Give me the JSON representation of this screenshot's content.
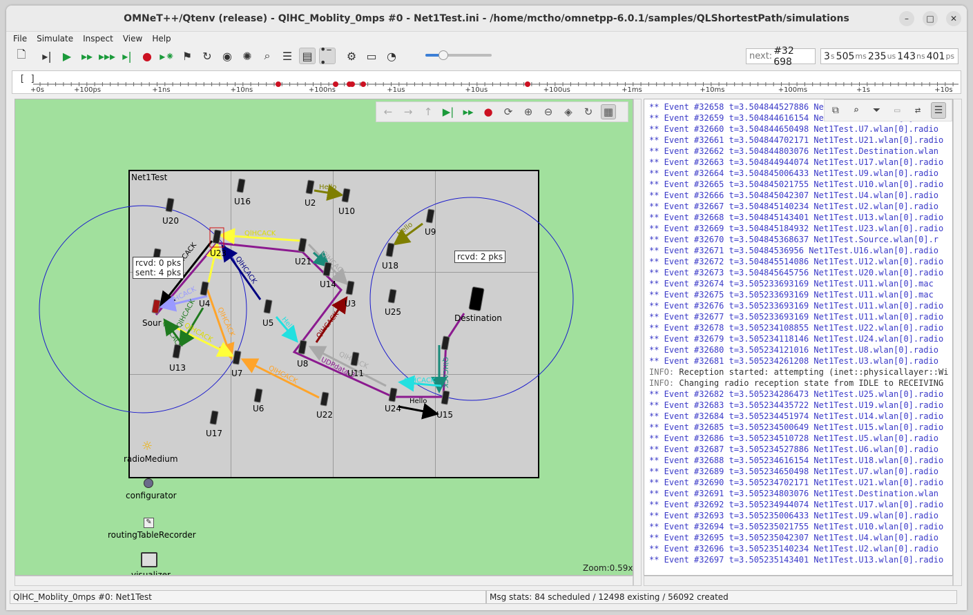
{
  "window": {
    "title": "OMNeT++/Qtenv (release) - QlHC_Moblity_0mps #0 - Net1Test.ini - /home/mctho/omnetpp-6.0.1/samples/QLShortestPath/simulations",
    "minimize_icon": "minimize-icon",
    "maximize_icon": "maximize-icon",
    "close_icon": "close-icon"
  },
  "menu": [
    "File",
    "Simulate",
    "Inspect",
    "View",
    "Help"
  ],
  "toolbar": {
    "icons": [
      "new-file-icon",
      "step-icon",
      "run-icon",
      "fast-run-icon",
      "express-run-icon",
      "run-until-icon",
      "stop-icon",
      "rebuild-icon",
      "flag-icon",
      "refresh-icon",
      "record-icon",
      "debug-icon",
      "find-icon",
      "layout-list-icon",
      "layout-split-icon",
      "layout-timeline-icon",
      "settings-icon",
      "camera-icon",
      "speed-icon"
    ],
    "speed_slider_level": 0.27
  },
  "status": {
    "next_label": "next:",
    "next_value": "#32 698",
    "sim_time": [
      {
        "value": "3",
        "unit": "s"
      },
      {
        "value": "505",
        "unit": "ms"
      },
      {
        "value": "235",
        "unit": "us"
      },
      {
        "value": "143",
        "unit": "ns"
      },
      {
        "value": "401",
        "unit": "ps"
      }
    ]
  },
  "timeline": {
    "labels": [
      "+0s",
      "+100ps",
      "+1ns",
      "+10ns",
      "+100ns",
      "+1us",
      "+10us",
      "+100us",
      "+1ms",
      "+10ms",
      "+100ms",
      "+1s",
      "+10s"
    ],
    "bracket": "[   ]",
    "event_markers": 6
  },
  "canvas": {
    "network_name": "Net1Test",
    "zoom": "Zoom:0.59x",
    "nodes": [
      "U16",
      "U2",
      "U10",
      "U20",
      "U9",
      "U23",
      "U21",
      "U18",
      "U14",
      "U3",
      "U4",
      "U5",
      "U25",
      "Source",
      "U8",
      "U13",
      "U7",
      "U11",
      "U24",
      "U15",
      "U6",
      "U22",
      "U17",
      "Destination"
    ],
    "source_label": "Sour",
    "bubbles": {
      "source": [
        "rcvd: 0 pks",
        "sent: 4 pks"
      ],
      "destination": "rcvd: 2 pks"
    },
    "messages": [
      "Hello",
      "Hello",
      "QlHCACK",
      "QlHCACK",
      "QlHCACK",
      "QlHCACK",
      "QlHCACK",
      "QlHCACK",
      "QlHCACK",
      "QlHCACK",
      "QlHCACK",
      "QlHCACK",
      "Hello",
      "QlHCACK",
      "UDPdata-3",
      "QlHCACK",
      "QlHCACK",
      "QlHCACK",
      "Hello"
    ],
    "modules": [
      "radioMedium",
      "configurator",
      "routingTableRecorder",
      "visualizer"
    ],
    "toolbar_icons": [
      "back-icon",
      "forward-icon",
      "up-icon",
      "run-local-icon",
      "fast-local-icon",
      "stop-local-icon",
      "relayout-icon",
      "zoom-in-icon",
      "zoom-out-icon",
      "layers-icon",
      "3d-icon",
      "canvas-mode-icon"
    ]
  },
  "log": {
    "toolbar_icons": [
      "copy-icon",
      "find-log-icon",
      "filter-icon",
      "settings-log-icon",
      "module-log-icon",
      "messages-view-icon"
    ],
    "lines": [
      {
        "t": "event",
        "text": "** Event #32658  t=3.504844527886  Net1Test.U6.wlan[0].radio"
      },
      {
        "t": "event",
        "text": "** Event #32659  t=3.504844616154  Net1Test.U18.wlan[0].radio"
      },
      {
        "t": "event",
        "text": "** Event #32660  t=3.504844650498  Net1Test.U7.wlan[0].radio"
      },
      {
        "t": "event",
        "text": "** Event #32661  t=3.504844702171  Net1Test.U21.wlan[0].radio"
      },
      {
        "t": "event",
        "text": "** Event #32662  t=3.504844803076  Net1Test.Destination.wlan"
      },
      {
        "t": "event",
        "text": "** Event #32663  t=3.504844944074  Net1Test.U17.wlan[0].radio"
      },
      {
        "t": "event",
        "text": "** Event #32664  t=3.504845006433  Net1Test.U9.wlan[0].radio"
      },
      {
        "t": "event",
        "text": "** Event #32665  t=3.504845021755  Net1Test.U10.wlan[0].radio"
      },
      {
        "t": "event",
        "text": "** Event #32666  t=3.504845042307  Net1Test.U4.wlan[0].radio"
      },
      {
        "t": "event",
        "text": "** Event #32667  t=3.504845140234  Net1Test.U2.wlan[0].radio"
      },
      {
        "t": "event",
        "text": "** Event #32668  t=3.504845143401  Net1Test.U13.wlan[0].radio"
      },
      {
        "t": "event",
        "text": "** Event #32669  t=3.504845184932  Net1Test.U23.wlan[0].radio"
      },
      {
        "t": "event",
        "text": "** Event #32670  t=3.504845368637  Net1Test.Source.wlan[0].r"
      },
      {
        "t": "event",
        "text": "** Event #32671  t=3.50484536956  Net1Test.U16.wlan[0].radio"
      },
      {
        "t": "event",
        "text": "** Event #32672  t=3.504845514086  Net1Test.U12.wlan[0].radio"
      },
      {
        "t": "event",
        "text": "** Event #32673  t=3.504845645756  Net1Test.U20.wlan[0].radio"
      },
      {
        "t": "event",
        "text": "** Event #32674  t=3.505233693169  Net1Test.U11.wlan[0].mac"
      },
      {
        "t": "event",
        "text": "** Event #32675  t=3.505233693169  Net1Test.U11.wlan[0].mac"
      },
      {
        "t": "event",
        "text": "** Event #32676  t=3.505233693169  Net1Test.U11.wlan[0].radio"
      },
      {
        "t": "event",
        "text": "** Event #32677  t=3.505233693169  Net1Test.U11.wlan[0].radio"
      },
      {
        "t": "event",
        "text": "** Event #32678  t=3.505234108855  Net1Test.U22.wlan[0].radio"
      },
      {
        "t": "event",
        "text": "** Event #32679  t=3.505234118146  Net1Test.U24.wlan[0].radio"
      },
      {
        "t": "event",
        "text": "** Event #32680  t=3.505234121016  Net1Test.U8.wlan[0].radio"
      },
      {
        "t": "event",
        "text": "** Event #32681  t=3.505234261208  Net1Test.U3.wlan[0].radio"
      },
      {
        "t": "info",
        "tag": "INFO:",
        "text": " Reception started: attempting (inet::physicallayer::Wi"
      },
      {
        "t": "info",
        "tag": "INFO:",
        "text": " Changing radio reception state from IDLE to RECEIVING"
      },
      {
        "t": "event",
        "text": "** Event #32682  t=3.505234286473  Net1Test.U25.wlan[0].radio"
      },
      {
        "t": "event",
        "text": "** Event #32683  t=3.505234435722  Net1Test.U19.wlan[0].radio"
      },
      {
        "t": "event",
        "text": "** Event #32684  t=3.505234451974  Net1Test.U14.wlan[0].radio"
      },
      {
        "t": "event",
        "text": "** Event #32685  t=3.505234500649  Net1Test.U15.wlan[0].radio"
      },
      {
        "t": "event",
        "text": "** Event #32686  t=3.505234510728  Net1Test.U5.wlan[0].radio"
      },
      {
        "t": "event",
        "text": "** Event #32687  t=3.505234527886  Net1Test.U6.wlan[0].radio"
      },
      {
        "t": "event",
        "text": "** Event #32688  t=3.505234616154  Net1Test.U18.wlan[0].radio"
      },
      {
        "t": "event",
        "text": "** Event #32689  t=3.505234650498  Net1Test.U7.wlan[0].radio"
      },
      {
        "t": "event",
        "text": "** Event #32690  t=3.505234702171  Net1Test.U21.wlan[0].radio"
      },
      {
        "t": "event",
        "text": "** Event #32691  t=3.505234803076  Net1Test.Destination.wlan"
      },
      {
        "t": "event",
        "text": "** Event #32692  t=3.505234944074  Net1Test.U17.wlan[0].radio"
      },
      {
        "t": "event",
        "text": "** Event #32693  t=3.505235006433  Net1Test.U9.wlan[0].radio"
      },
      {
        "t": "event",
        "text": "** Event #32694  t=3.505235021755  Net1Test.U10.wlan[0].radio"
      },
      {
        "t": "event",
        "text": "** Event #32695  t=3.505235042307  Net1Test.U4.wlan[0].radio"
      },
      {
        "t": "event",
        "text": "** Event #32696  t=3.505235140234  Net1Test.U2.wlan[0].radio"
      },
      {
        "t": "event",
        "text": "** Event #32697  t=3.505235143401  Net1Test.U13.wlan[0].radio"
      }
    ]
  },
  "statusbar": {
    "left": "QlHC_Moblity_0mps #0: Net1Test",
    "right": "Msg stats: 84 scheduled / 12498 existing / 56092 created"
  },
  "colors": {
    "canvas_bg": "#a1e09d",
    "network_bg": "#cfcfcf",
    "route": "#8b1a8f",
    "range_circle": "#1a1acc",
    "log_event": "#3a3ac8",
    "run_green": "#1a9a3a",
    "stop_red": "#cc1122"
  }
}
